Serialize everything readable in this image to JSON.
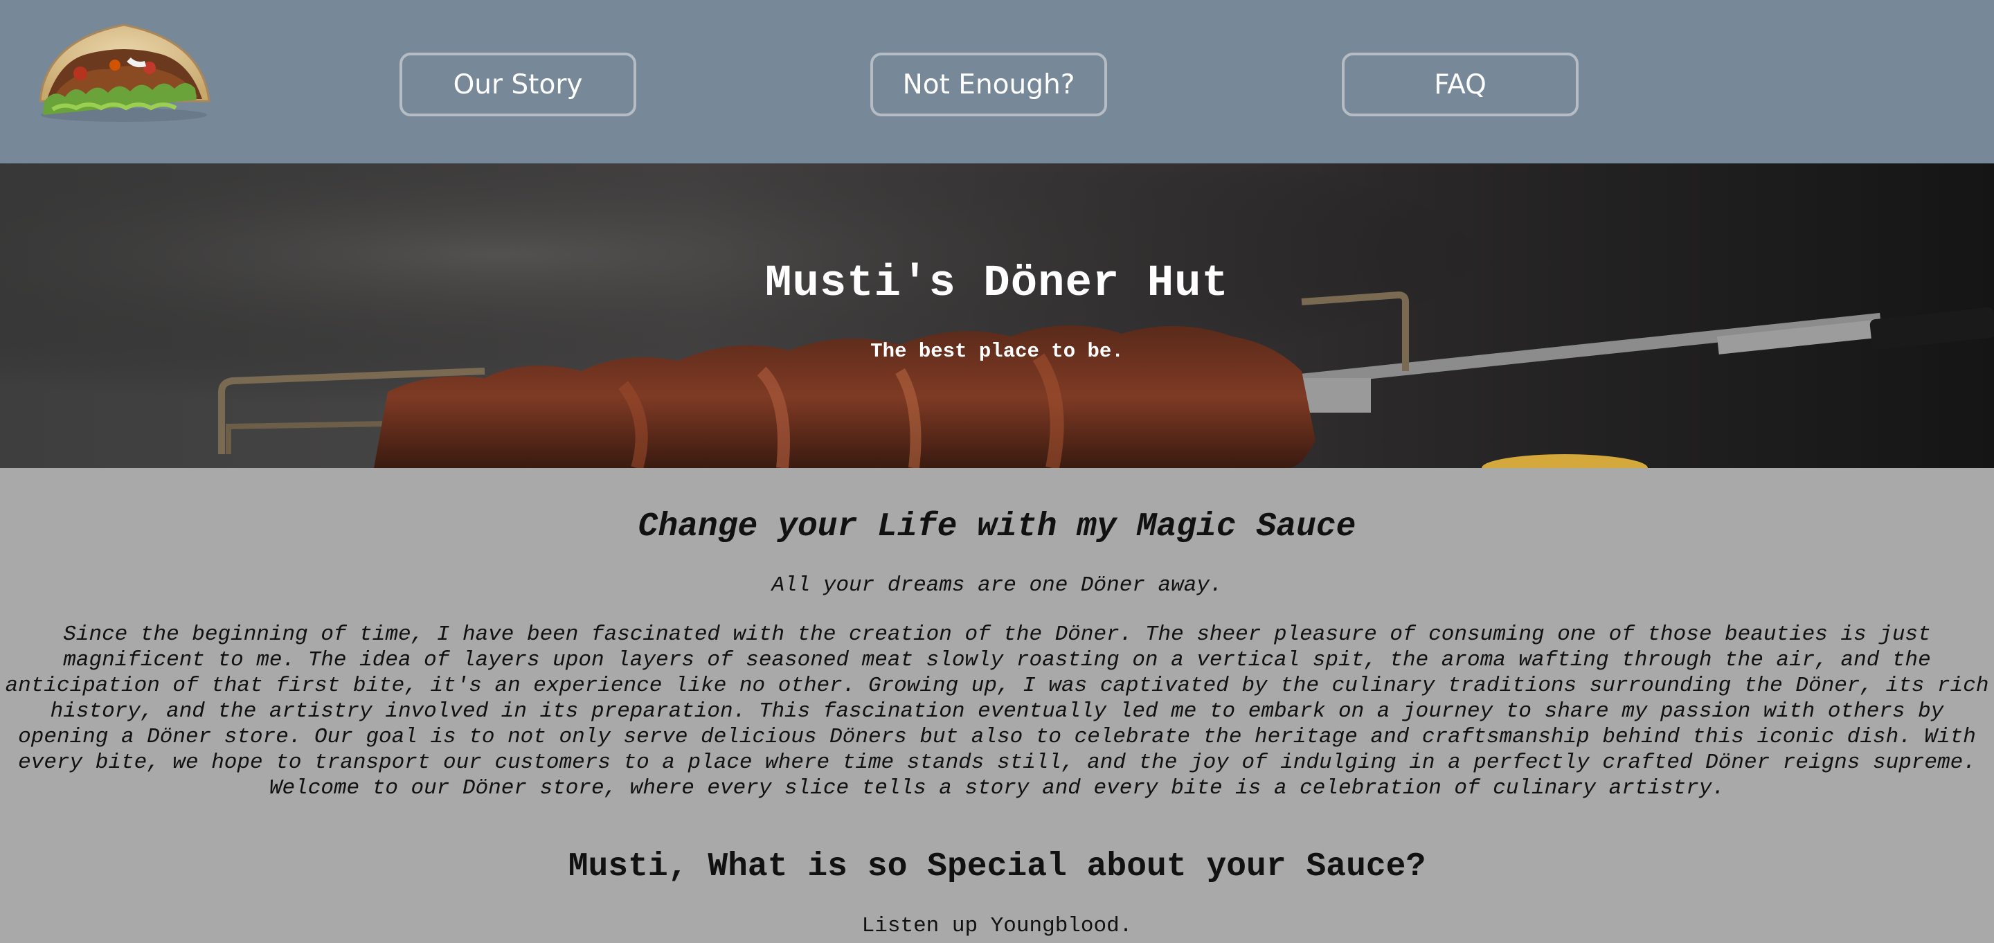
{
  "nav": {
    "items": [
      {
        "label": "Our Story"
      },
      {
        "label": "Not Enough?"
      },
      {
        "label": "FAQ"
      }
    ]
  },
  "hero": {
    "title": "Musti's Döner Hut",
    "subtitle": "The best place to be."
  },
  "main": {
    "heading": "Change your Life with my Magic Sauce",
    "tagline": "All your dreams are one Döner away.",
    "story": "Since the beginning of time, I have been fascinated with the creation of the Döner. The sheer pleasure of consuming one of those beauties is just magnificent to me. The idea of layers upon layers of seasoned meat slowly roasting on a vertical spit, the aroma wafting through the air, and the anticipation of that first bite, it's an experience like no other. Growing up, I was captivated by the culinary traditions surrounding the Döner, its rich history, and the artistry involved in its preparation. This fascination eventually led me to embark on a journey to share my passion with others by opening a Döner store. Our goal is to not only serve delicious Döners but also to celebrate the heritage and craftsmanship behind this iconic dish. With every bite, we hope to transport our customers to a place where time stands still, and the joy of indulging in a perfectly crafted Döner reigns supreme. Welcome to our Döner store, where every slice tells a story and every bite is a celebration of culinary artistry.",
    "special_heading": "Musti, What is so Special about your Sauce?",
    "special_intro": "Listen up Youngblood."
  },
  "colors": {
    "navbar": "#778899",
    "content_bg": "#a9a9a9",
    "nav_border": "#b5bcc3"
  }
}
